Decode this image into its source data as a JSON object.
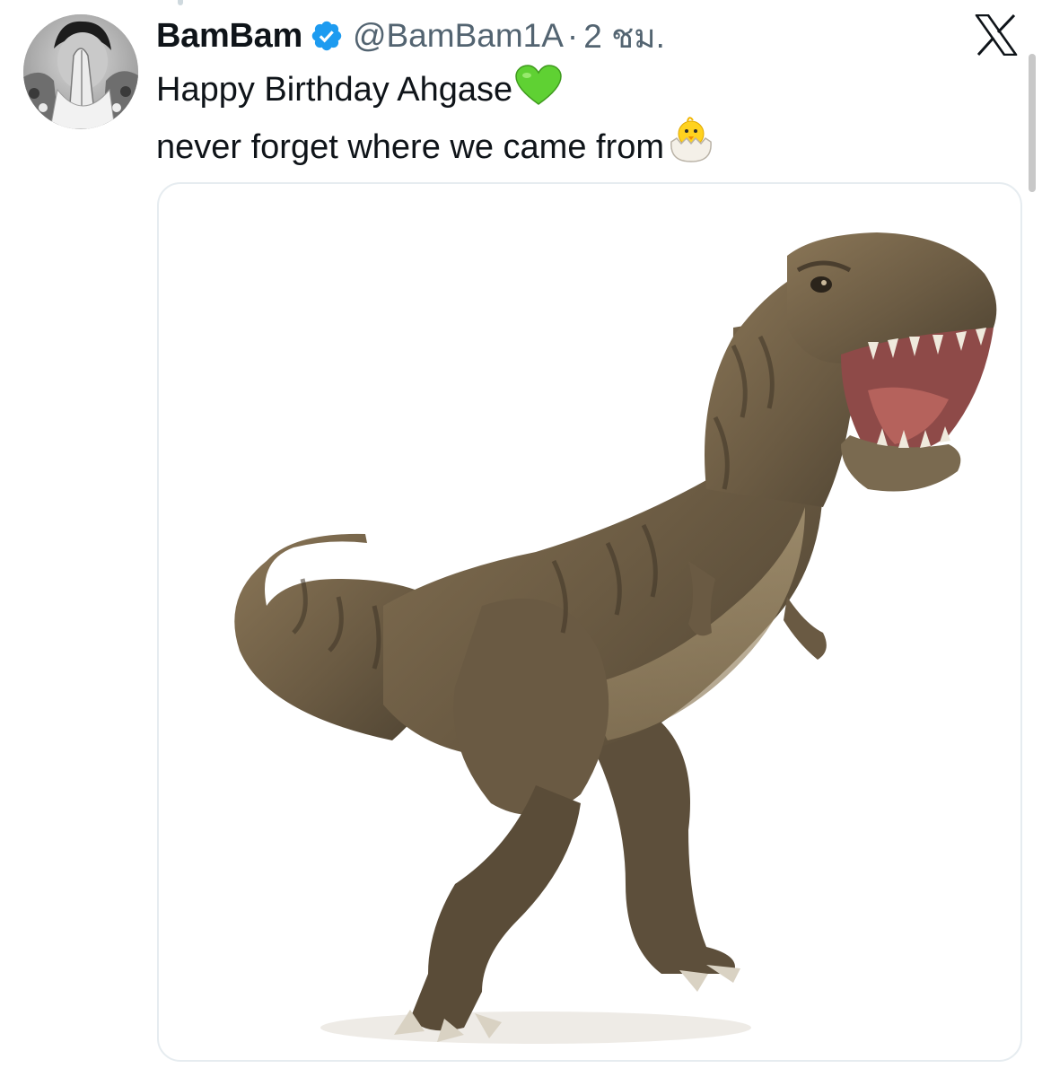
{
  "tweet": {
    "display_name": "BamBam",
    "handle": "@BamBam1A",
    "separator": "·",
    "time": "2 ชม.",
    "text_line_1": "Happy Birthday Ahgase",
    "text_line_2": "never forget where we came from",
    "emoji_1": "green-heart-emoji",
    "emoji_2": "hatching-chick-emoji"
  },
  "icons": {
    "verified": "verified-badge-icon",
    "brand": "x-logo-icon"
  },
  "colors": {
    "text": "#0f1419",
    "secondary_text": "#536471",
    "verified_blue": "#1d9bf0",
    "card_border": "#e6ecf0",
    "heart_green": "#5fd133"
  },
  "media": {
    "type": "photo",
    "subject": "tyrannosaurus-rex"
  }
}
